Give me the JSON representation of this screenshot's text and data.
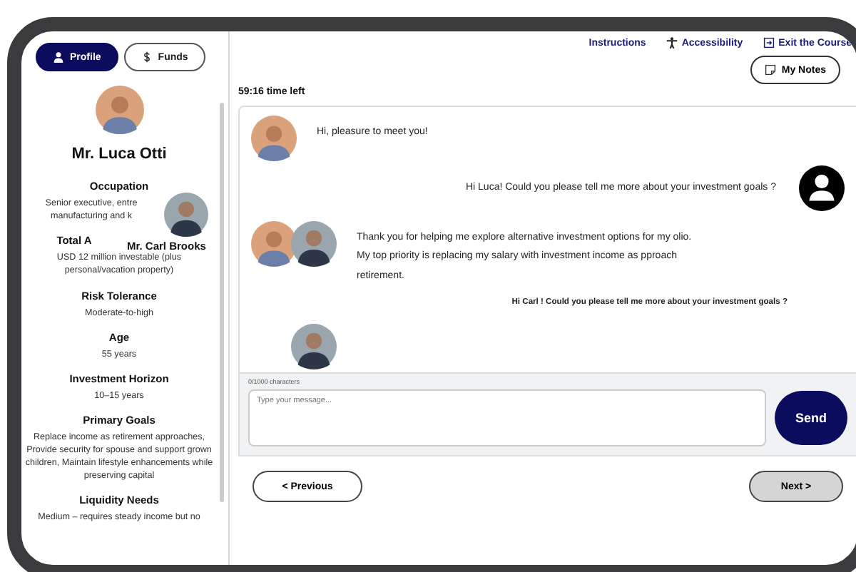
{
  "sidebar": {
    "tabs": [
      {
        "label": "Profile",
        "selected": true
      },
      {
        "label": "Funds",
        "selected": false
      }
    ],
    "client_name": "Mr. Luca Otti",
    "overlay_name": "Mr. Carl Brooks",
    "sections": [
      {
        "label": "Occupation",
        "value": "Senior executive, entre\nmanufacturing and k"
      },
      {
        "label": "Total A",
        "value": "USD 12 million investable (plus personal/vacation property)"
      },
      {
        "label": "Risk Tolerance",
        "value": "Moderate-to-high"
      },
      {
        "label": "Age",
        "value": "55 years"
      },
      {
        "label": "Investment Horizon",
        "value": "10–15 years"
      },
      {
        "label": "Primary Goals",
        "value": "Replace income as retirement approaches, Provide security for spouse and support grown children, Maintain lifestyle enhancements while preserving capital"
      },
      {
        "label": "Liquidity Needs",
        "value": "Medium – requires steady income but no"
      }
    ]
  },
  "top_links": [
    {
      "label": "Instructions"
    },
    {
      "label": "Accessibility"
    },
    {
      "label": "Exit the Course"
    }
  ],
  "notes_button": "My Notes",
  "timer": "59:16 time left",
  "messages": [
    {
      "kind": "client",
      "text": "Hi, pleasure to meet you!"
    },
    {
      "kind": "advisor",
      "text": "Hi Luca! Could you please tell me more about your investment goals ?"
    },
    {
      "kind": "client-double",
      "text": "Thank you for helping me explore alternative investment options for my olio. My top priority is replacing my salary with investment income as pproach retirement."
    },
    {
      "kind": "advisor-plain",
      "text": "Hi Carl ! Could you please tell me more about your investment goals ?"
    },
    {
      "kind": "avatar-only"
    }
  ],
  "composer": {
    "counter": "0/1000 characters",
    "placeholder": "Type your message...",
    "send": "Send"
  },
  "nav": {
    "previous": "< Previous",
    "next": "Next >"
  }
}
